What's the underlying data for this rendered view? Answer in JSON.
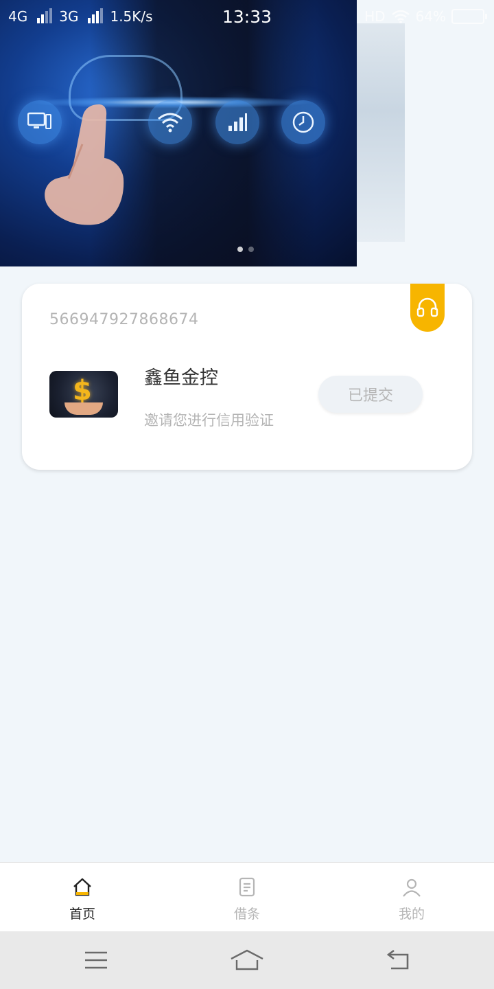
{
  "status_bar": {
    "net1": "4G",
    "net2": "3G",
    "speed": "1.5K/s",
    "time": "13:33",
    "hd": "HD",
    "battery": "64%"
  },
  "banner": {
    "slide_index": 1,
    "slide_count": 2
  },
  "card": {
    "id_number": "566947927868674",
    "app_name": "鑫鱼金控",
    "description": "邀请您进行信用验证",
    "status_button": "已提交",
    "tag_icon": "headset-icon",
    "accent_color": "#f7b500"
  },
  "tabbar": {
    "tabs": [
      {
        "label": "首页",
        "icon": "home-icon",
        "active": true
      },
      {
        "label": "借条",
        "icon": "document-icon",
        "active": false
      },
      {
        "label": "我的",
        "icon": "user-icon",
        "active": false
      }
    ]
  },
  "system_nav": {
    "menu_icon": "menu-icon",
    "home_icon": "home-outline-icon",
    "back_icon": "back-icon"
  }
}
